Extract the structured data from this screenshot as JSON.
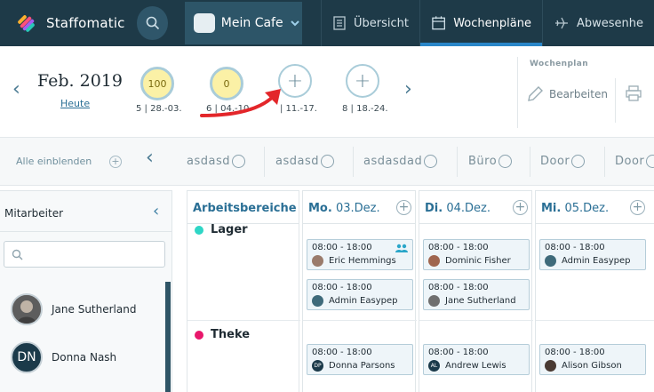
{
  "nav": {
    "brand": "Staffomatic",
    "company": "Mein Cafe",
    "tabs": [
      {
        "label": "Übersicht",
        "icon": "list-icon"
      },
      {
        "label": "Wochenpläne",
        "icon": "calendar-icon",
        "active": true
      },
      {
        "label": "Abwesenhe",
        "icon": "plane-icon"
      }
    ]
  },
  "weekbar": {
    "month": "Feb. 2019",
    "today": "Heute",
    "weeks": [
      {
        "value": "100",
        "label": "5 | 28.-03."
      },
      {
        "value": "0",
        "label": "6 | 04.-10."
      },
      {
        "value": "+",
        "label": "| 11.-17."
      },
      {
        "value": "+",
        "label": "8 | 18.-24."
      }
    ],
    "section_title": "Wochenplan",
    "edit_label": "Bearbeiten"
  },
  "filters": {
    "show_all": "Alle einblenden",
    "items": [
      "asdasd",
      "asdasd",
      "asdasdad",
      "Büro",
      "Door",
      "Door"
    ]
  },
  "employees": {
    "title": "Mitarbeiter",
    "list": [
      {
        "name": "Jane Sutherland",
        "initials": ""
      },
      {
        "name": "Donna Nash",
        "initials": "DN"
      }
    ]
  },
  "schedule": {
    "areas_header": "Arbeitsbereiche",
    "days": [
      {
        "day": "Mo.",
        "date": "03.Dez."
      },
      {
        "day": "Di.",
        "date": "04.Dez."
      },
      {
        "day": "Mi.",
        "date": "05.Dez."
      }
    ],
    "areas": [
      {
        "name": "Lager",
        "color": "#2fd6c6"
      },
      {
        "name": "Theke",
        "color": "#e8176b"
      }
    ],
    "shifts": {
      "lager": [
        [
          {
            "time": "08:00 - 18:00",
            "person": "Eric Hemmings"
          },
          {
            "time": "08:00 - 18:00",
            "person": "Admin Easypep"
          }
        ],
        [
          {
            "time": "08:00 - 18:00",
            "person": "Dominic Fisher"
          },
          {
            "time": "08:00 - 18:00",
            "person": "Jane Sutherland"
          }
        ],
        [
          {
            "time": "08:00 - 18:00",
            "person": "Admin Easypep"
          }
        ]
      ],
      "theke": [
        {
          "time": "08:00 - 18:00",
          "person": "Donna Parsons",
          "initials": "DP"
        },
        {
          "time": "08:00 - 18:00",
          "person": "Andrew Lewis",
          "initials": "AL"
        },
        {
          "time": "08:00 - 18:00",
          "person": "Alison Gibson"
        }
      ]
    }
  },
  "colors": {
    "nav_bg": "#1e3a48",
    "accent": "#2a86c8",
    "arrow": "#e3262a"
  }
}
